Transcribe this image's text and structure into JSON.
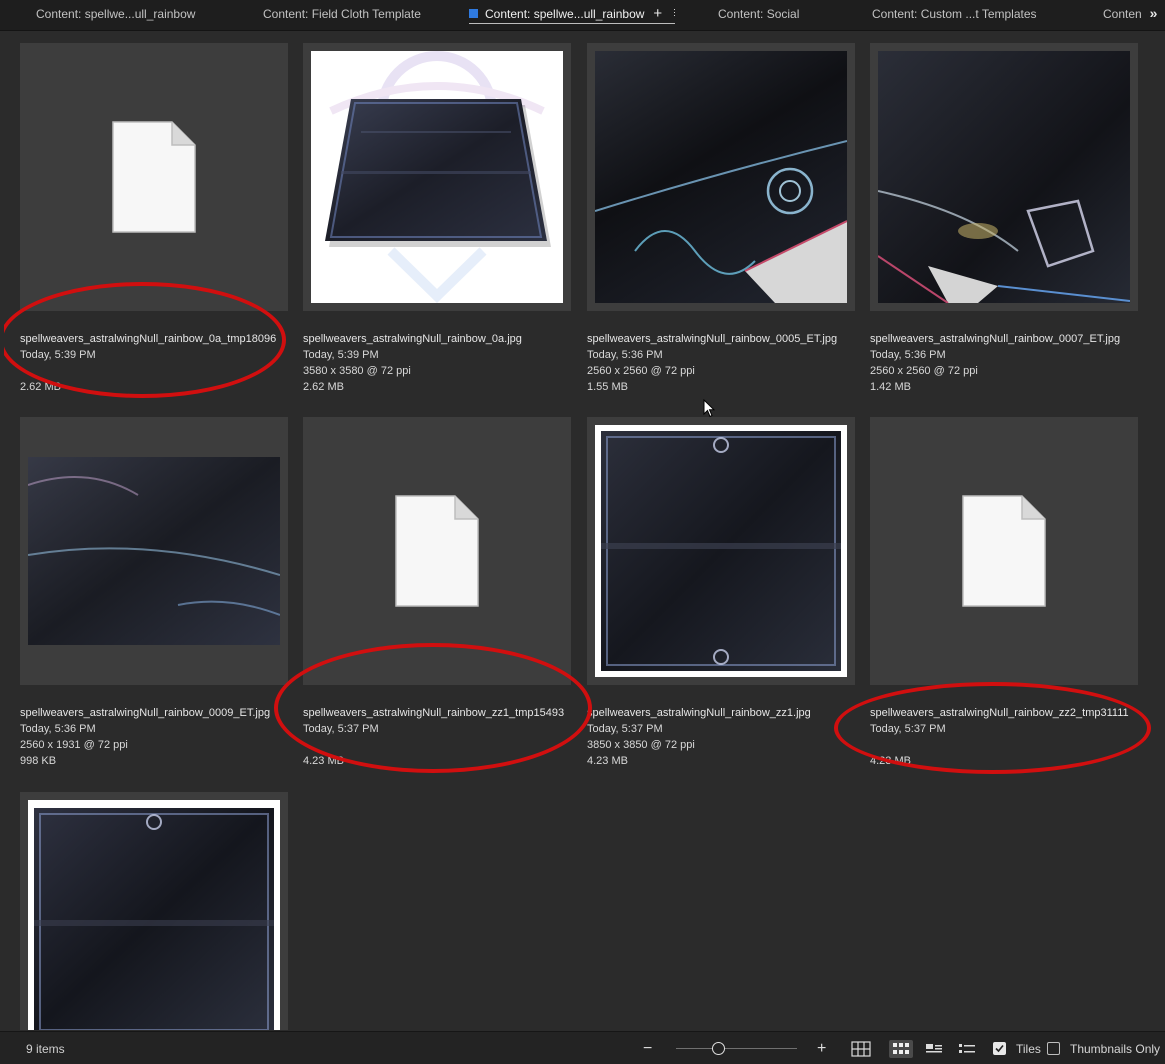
{
  "tabs": [
    {
      "label": "Content: spellwe...ull_rainbow",
      "active": false
    },
    {
      "label": "Content: Field Cloth Template",
      "active": false
    },
    {
      "label": "Content: spellwe...ull_rainbow",
      "active": true,
      "color": "#2f7ae0"
    },
    {
      "label": "Content: Social",
      "active": false
    },
    {
      "label": "Content: Custom ...t Templates",
      "active": false
    },
    {
      "label": "Content",
      "active": false
    }
  ],
  "tab_add_glyph": "+",
  "tab_overflow_glyph": "»",
  "items": [
    {
      "filename": "spellweavers_astralwingNull_rainbow_0a_tmp18096",
      "date": "Today, 5:39 PM",
      "dims": "",
      "size": "2.62 MB",
      "thumb": "file-icon",
      "annotated": true
    },
    {
      "filename": "spellweavers_astralwingNull_rainbow_0a.jpg",
      "date": "Today, 5:39 PM",
      "dims": "3580 x 3580 @ 72 ppi",
      "size": "2.62 MB",
      "thumb": "rug-render-white",
      "annotated": false
    },
    {
      "filename": "spellweavers_astralwingNull_rainbow_0005_ET.jpg",
      "date": "Today, 5:36 PM",
      "dims": "2560 x 2560 @ 72 ppi",
      "size": "1.55 MB",
      "thumb": "rug-fold-closeup",
      "annotated": false
    },
    {
      "filename": "spellweavers_astralwingNull_rainbow_0007_ET.jpg",
      "date": "Today, 5:36 PM",
      "dims": "2560 x 2560 @ 72 ppi",
      "size": "1.42 MB",
      "thumb": "rug-corner-closeup",
      "annotated": false
    },
    {
      "filename": "spellweavers_astralwingNull_rainbow_0009_ET.jpg",
      "date": "Today, 5:36 PM",
      "dims": "2560 x 1931 @ 72 ppi",
      "size": "998 KB",
      "thumb": "rug-texture-wide",
      "annotated": false
    },
    {
      "filename": "spellweavers_astralwingNull_rainbow_zz1_tmp15493",
      "date": "Today, 5:37 PM",
      "dims": "",
      "size": "4.23 MB",
      "thumb": "file-icon",
      "annotated": true
    },
    {
      "filename": "spellweavers_astralwingNull_rainbow_zz1.jpg",
      "date": "Today, 5:37 PM",
      "dims": "3850 x 3850 @ 72 ppi",
      "size": "4.23 MB",
      "thumb": "rug-flat-square",
      "annotated": false
    },
    {
      "filename": "spellweavers_astralwingNull_rainbow_zz2_tmp31111",
      "date": "Today, 5:37 PM",
      "dims": "",
      "size": "4.23 MB",
      "thumb": "file-icon",
      "annotated": true
    },
    {
      "filename": "",
      "date": "",
      "dims": "",
      "size": "",
      "thumb": "rug-flat-portrait",
      "annotated": false
    }
  ],
  "status": {
    "item_count": "9 items",
    "zoom_out_glyph": "−",
    "zoom_in_glyph": "+",
    "zoom_level": 0.35,
    "tiles_label": "Tiles",
    "tiles_checked": true,
    "thumbs_only_label": "Thumbnails Only",
    "thumbs_only_checked": false
  },
  "colors": {
    "annotation": "#d10f0f",
    "accent": "#2f7ae0",
    "panel_bg": "#2b2b2b",
    "tile_bg": "#3d3d3d"
  }
}
